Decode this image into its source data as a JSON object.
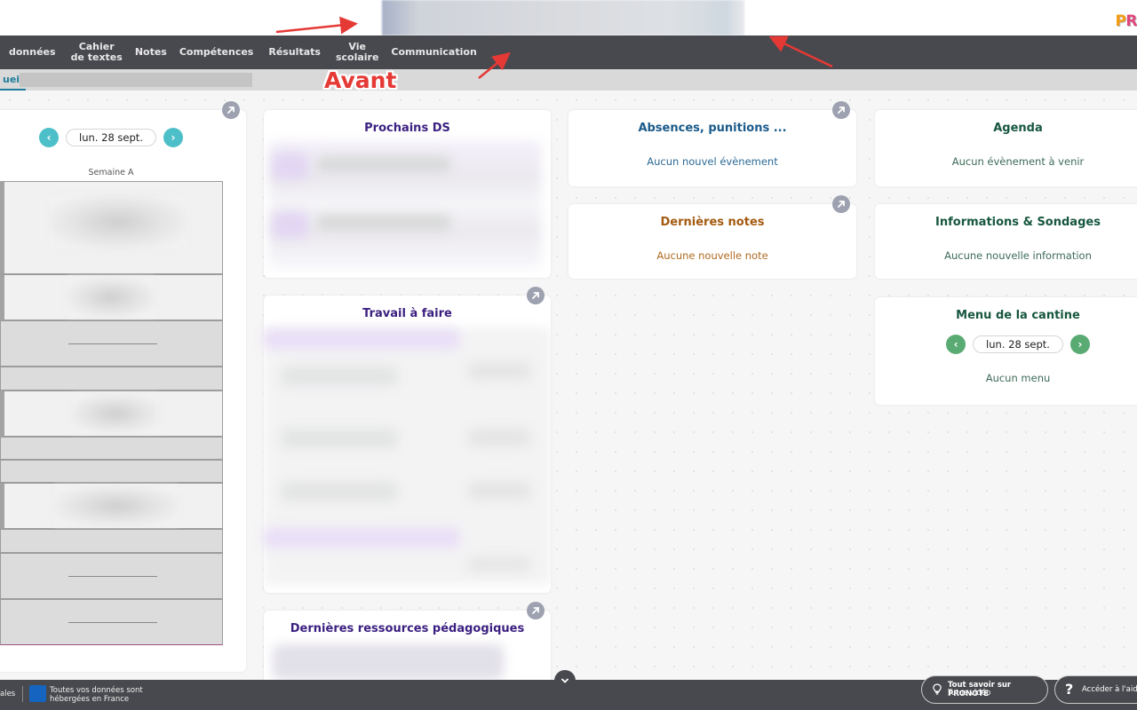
{
  "header": {
    "brand_logo_p": "P",
    "brand_logo_r": "R"
  },
  "nav": {
    "items": [
      {
        "line1": "données",
        "line2": ""
      },
      {
        "line1": "Cahier",
        "line2": "de textes"
      },
      {
        "line1": "Notes",
        "line2": ""
      },
      {
        "line1": "Compétences",
        "line2": ""
      },
      {
        "line1": "Résultats",
        "line2": ""
      },
      {
        "line1": "Vie",
        "line2": "scolaire"
      },
      {
        "line1": "Communication",
        "line2": ""
      }
    ]
  },
  "tabs": {
    "active_label": "ueil"
  },
  "annotation": {
    "label": "Avant",
    "color": "#e53935"
  },
  "timetable": {
    "date": "lun. 28 sept.",
    "week_label": "Semaine A",
    "prev_icon": "‹",
    "next_icon": "›"
  },
  "widgets": {
    "prochains_ds": {
      "title": "Prochains DS",
      "color": "#3b1f80"
    },
    "travail": {
      "title": "Travail à faire",
      "color": "#3b1f80"
    },
    "ressources": {
      "title": "Dernières ressources pédagogiques",
      "color": "#3b1f80"
    },
    "absences": {
      "title": "Absences, punitions ...",
      "empty": "Aucun nouvel évènement",
      "color": "#1a5a8a"
    },
    "notes": {
      "title": "Dernières notes",
      "empty": "Aucune nouvelle note",
      "color": "#a35a10"
    },
    "agenda": {
      "title": "Agenda",
      "empty": "Aucun évènement à venir",
      "color": "#17573f"
    },
    "informations": {
      "title": "Informations & Sondages",
      "empty": "Aucune nouvelle information",
      "color": "#17573f"
    },
    "cantine": {
      "title": "Menu de la cantine",
      "date": "lun. 28 sept.",
      "empty": "Aucun menu",
      "color": "#17573f",
      "prev_icon": "‹",
      "next_icon": "›"
    }
  },
  "footer": {
    "legal_partial": "ales",
    "hosting_line1": "Toutes vos données sont",
    "hosting_line2": "hébergées en France",
    "tutos_title": "Tout savoir sur PRONOTE",
    "tutos_sub": "Tutos vidéo",
    "help_label": "Accéder à l'aide",
    "help_icon": "?",
    "collapse_icon": "⌄"
  },
  "colors": {
    "nav_bg": "#48494e",
    "teal_accent": "#4dbfc8",
    "green_accent": "#5aab73",
    "expand_btn": "#9ea2b0"
  }
}
